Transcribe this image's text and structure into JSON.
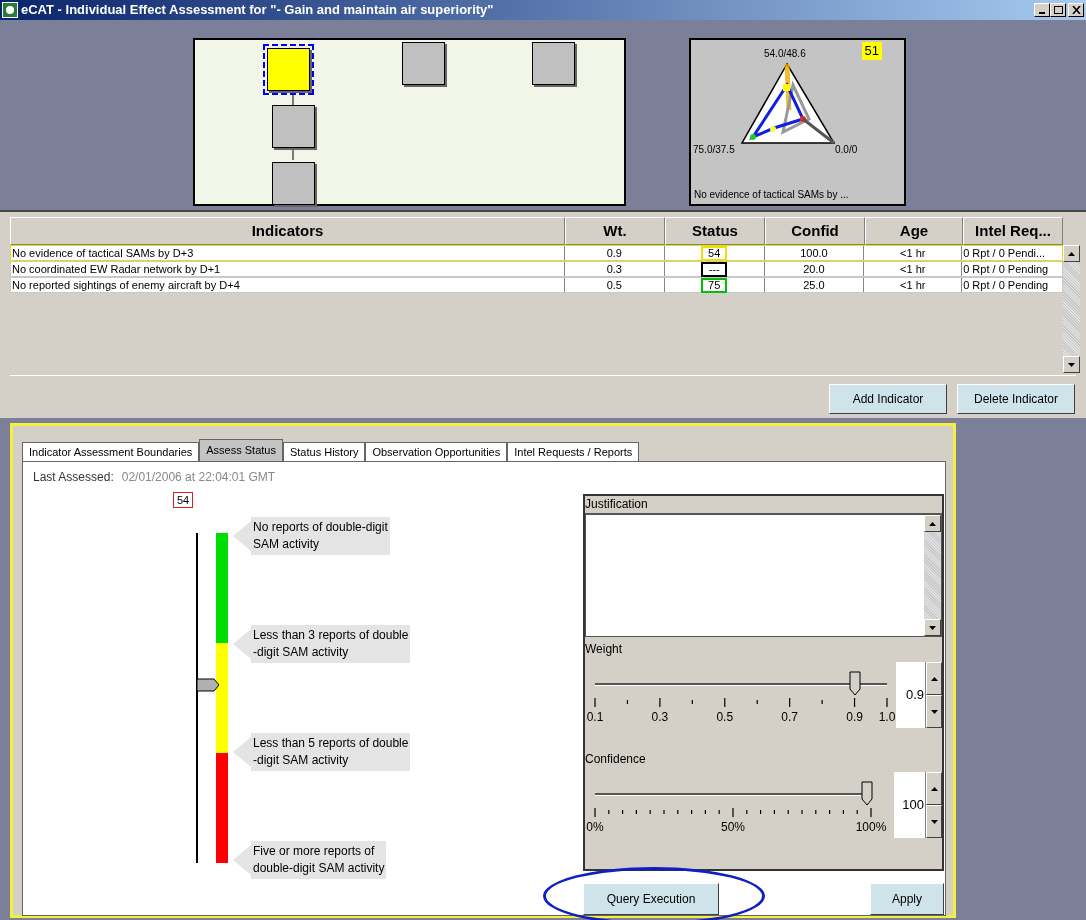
{
  "window": {
    "title": "eCAT - Individual Effect Assessment for  \"- Gain and maintain air superiority\""
  },
  "diagram": {
    "nodes": [
      {
        "selected": true
      },
      {
        "selected": false
      },
      {
        "selected": false
      },
      {
        "selected": false
      },
      {
        "selected": false
      }
    ]
  },
  "radar": {
    "score": "51",
    "labels": [
      "54.0/48.6",
      "75.0/37.5",
      "0.0/0"
    ],
    "caption": "No evidence of tactical SAMs by ..."
  },
  "table": {
    "columns": [
      "Indicators",
      "Wt.",
      "Status",
      "Confid",
      "Age",
      "Intel Req..."
    ],
    "rows": [
      {
        "name": "No evidence of tactical SAMs by D+3",
        "weight": "0.9",
        "status": "54",
        "color": "#f0e000",
        "confid": "100.0",
        "age": "<1 hr",
        "intel": "0 Rpt / 0 Pendi...",
        "selected": true
      },
      {
        "name": "No coordinated EW Radar network by D+1",
        "weight": "0.3",
        "status": "---",
        "color": "#000000",
        "confid": "20.0",
        "age": "<1 hr",
        "intel": "0 Rpt / 0 Pending",
        "selected": false
      },
      {
        "name": "No reported sightings of enemy aircraft by D+4",
        "weight": "0.5",
        "status": "75",
        "color": "#00c000",
        "confid": "25.0",
        "age": "<1 hr",
        "intel": "0 Rpt / 0 Pending",
        "selected": false
      }
    ]
  },
  "table_buttons": [
    "Add Indicator",
    "Delete Indicator"
  ],
  "tabs": [
    {
      "label": "Indicator Assessment Boundaries",
      "selected": false
    },
    {
      "label": "Assess Status",
      "selected": true
    },
    {
      "label": "Status History",
      "selected": false
    },
    {
      "label": "Observation Opportunities",
      "selected": false
    },
    {
      "label": "Intel Requests / Reports",
      "selected": false
    }
  ],
  "last_assessed": {
    "label": "Last Assessed:",
    "value": "02/01/2006 at 22:04:01 GMT"
  },
  "scale": {
    "value": "54",
    "level": 0.54,
    "bands": [
      {
        "color": "#00dd00"
      },
      {
        "color": "#ffff00"
      },
      {
        "color": "#ff0000"
      }
    ],
    "labels": [
      "No reports of double-digit\nSAM activity",
      "Less than 3 reports of double\n-digit SAM activity",
      "Less than 5 reports of double\n-digit SAM activity",
      "Five or more reports of\ndouble-digit SAM activity"
    ]
  },
  "justification": {
    "label": "Justification"
  },
  "weight": {
    "label": "Weight",
    "level": 0.889,
    "value": "0.9",
    "ticks": [
      "0.1",
      "0.3",
      "0.5",
      "0.7",
      "0.9",
      "1.0"
    ]
  },
  "confidence": {
    "label": "Confidence",
    "level": 0.985,
    "value": "100",
    "ticks": [
      "0%",
      "50%",
      "100%"
    ]
  },
  "actions": [
    {
      "label": "Query Execution",
      "highlighted": true
    },
    {
      "label": "Apply",
      "highlighted": false
    }
  ]
}
